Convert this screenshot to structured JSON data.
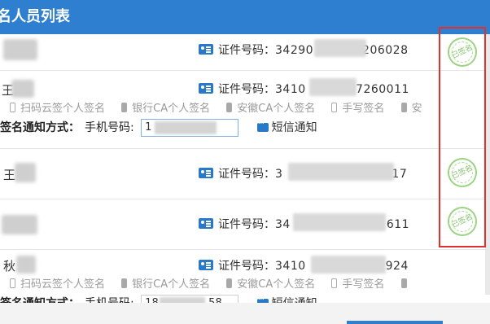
{
  "header": {
    "title": "名人员列表"
  },
  "signers": [
    {
      "name_prefix": "",
      "id_label": "证件号码：",
      "id_start": "34290",
      "id_end": "206028",
      "status": "已签名"
    },
    {
      "name_prefix": "王",
      "id_label": "证件号码：",
      "id_start": "3410",
      "id_end": "07260011",
      "status": ""
    },
    {
      "name_prefix": "王",
      "id_label": "证件号码：",
      "id_start": "3",
      "id_end": "17",
      "status": "已签名"
    },
    {
      "name_prefix": "",
      "id_label": "证件号码：",
      "id_start": "34",
      "id_end": "611",
      "status": "已签名"
    },
    {
      "name_prefix": "秋",
      "id_label": "证件号码：",
      "id_start": "3410",
      "id_end": "924",
      "status": ""
    }
  ],
  "sign_methods": [
    {
      "label": "扫码云签个人签名",
      "icon": "phone-icon"
    },
    {
      "label": "银行CA个人签名",
      "icon": "usb-key-icon"
    },
    {
      "label": "安徽CA个人签名",
      "icon": "usb-key-icon"
    },
    {
      "label": "手写签名",
      "icon": "tablet-icon"
    },
    {
      "label": "安",
      "icon": "usb-key-icon"
    }
  ],
  "notify": {
    "label": "签名通知方式：",
    "phone_label": "手机号码:",
    "phone_value_1": "1",
    "phone_value_2": "18",
    "phone_value_2_end": "58",
    "sms_label": "短信通知"
  },
  "colors": {
    "header": "#2f7fd0",
    "stamp": "#6cb84d",
    "highlight": "#e03030"
  }
}
